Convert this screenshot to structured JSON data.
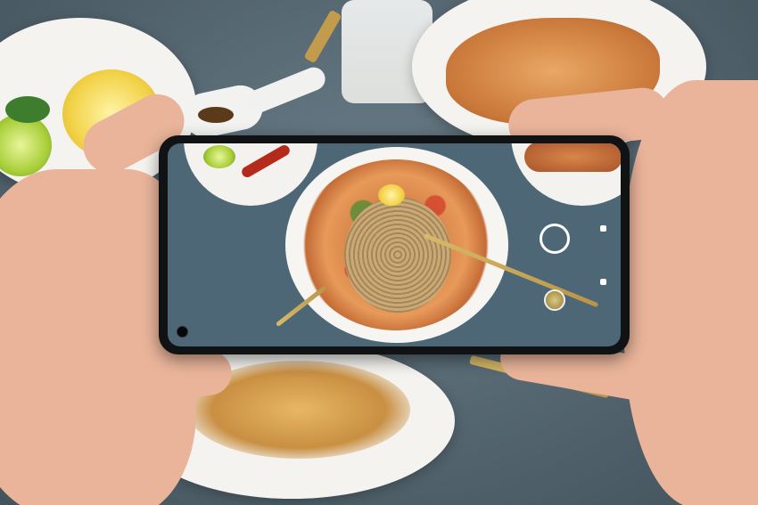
{
  "scene": {
    "subject": "hands-holding-phone-photographing-food",
    "colors": {
      "table": "#5d6f7a",
      "plate": "#f4f3ef",
      "noodles": "#c8a979",
      "phone_body": "#101214",
      "skin": "#e9b49a"
    }
  },
  "camera_ui": {
    "icons": {
      "shutter": "shutter-ring-icon",
      "front_camera": "front-camera-hole-icon",
      "gallery": "gallery-thumbnail-icon",
      "mode_dot_top": "mode-indicator-icon",
      "mode_dot_bottom": "mode-indicator-icon"
    }
  }
}
